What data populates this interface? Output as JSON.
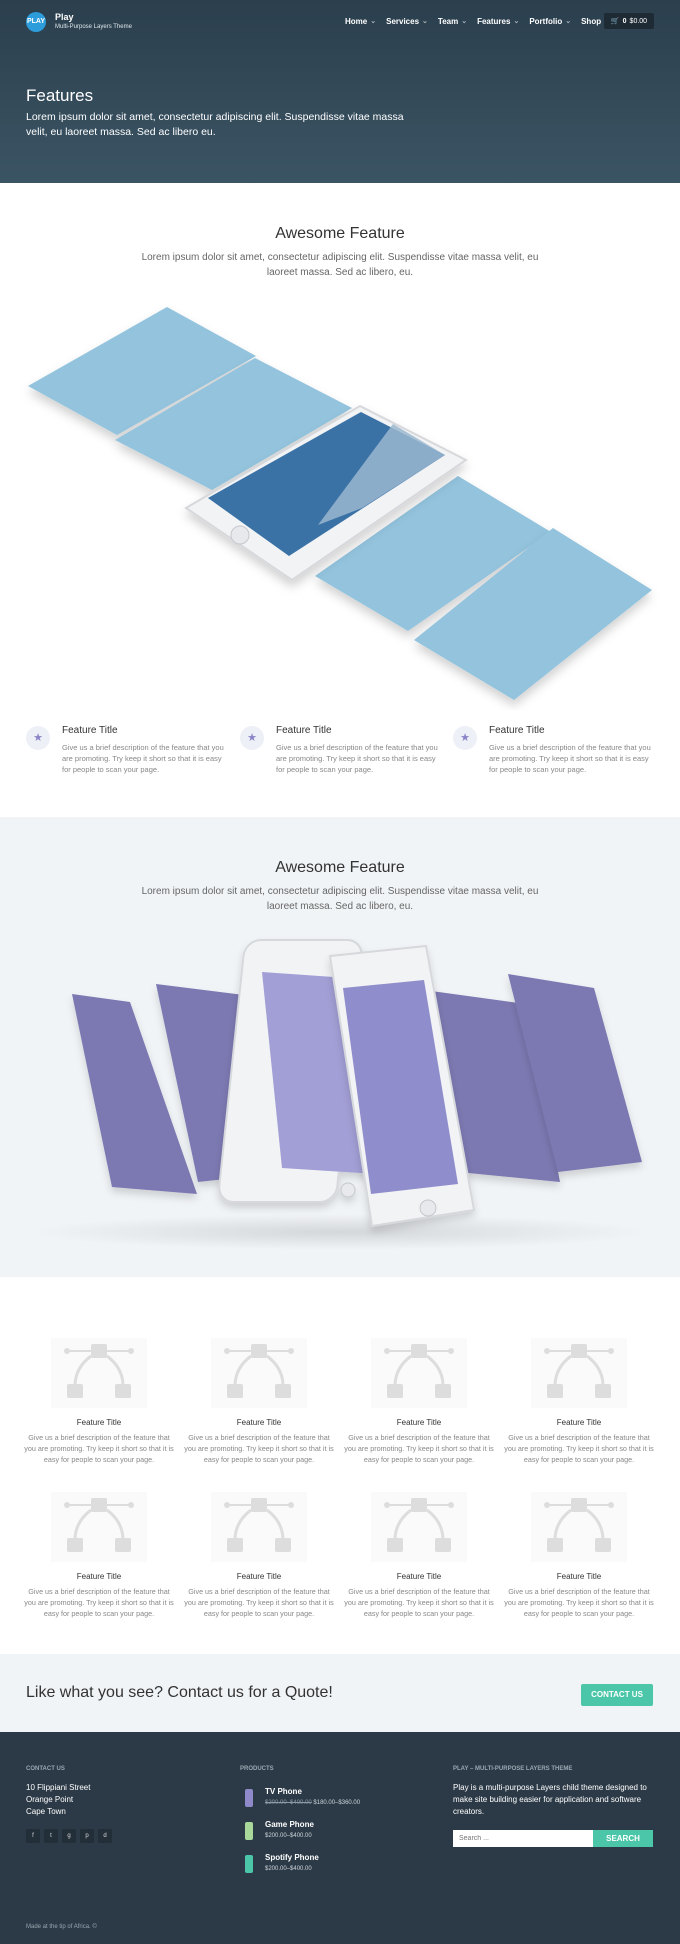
{
  "header": {
    "logo_text": "PLAY",
    "brand": "Play",
    "tagline": "Multi-Purpose Layers Theme",
    "nav": [
      "Home",
      "Services",
      "Team",
      "Features",
      "Portfolio",
      "Shop"
    ],
    "cart_count": "0",
    "cart_total": "$0.00"
  },
  "hero": {
    "title": "Features",
    "intro": "Lorem ipsum dolor sit amet, consectetur adipiscing elit. Suspendisse vitae massa velit, eu laoreet massa. Sed ac libero eu."
  },
  "section1": {
    "title": "Awesome Feature",
    "text": "Lorem ipsum dolor sit amet, consectetur adipiscing elit. Suspendisse vitae massa velit, eu laoreet massa. Sed ac libero, eu.",
    "features": [
      {
        "title": "Feature Title",
        "desc": "Give us a brief description of the feature that you are promoting. Try keep it short so that it is easy for people to scan your page."
      },
      {
        "title": "Feature Title",
        "desc": "Give us a brief description of the feature that you are promoting. Try keep it short so that it is easy for people to scan your page."
      },
      {
        "title": "Feature Title",
        "desc": "Give us a brief description of the feature that you are promoting. Try keep it short so that it is easy for people to scan your page."
      }
    ]
  },
  "section2": {
    "title": "Awesome Feature",
    "text": "Lorem ipsum dolor sit amet, consectetur adipiscing elit. Suspendisse vitae massa velit, eu laoreet massa. Sed ac libero, eu."
  },
  "grid": [
    {
      "title": "Feature Title",
      "desc": "Give us a brief description of the feature that you are promoting. Try keep it short so that it is easy for people to scan your page."
    },
    {
      "title": "Feature Title",
      "desc": "Give us a brief description of the feature that you are promoting. Try keep it short so that it is easy for people to scan your page."
    },
    {
      "title": "Feature Title",
      "desc": "Give us a brief description of the feature that you are promoting. Try keep it short so that it is easy for people to scan your page."
    },
    {
      "title": "Feature Title",
      "desc": "Give us a brief description of the feature that you are promoting. Try keep it short so that it is easy for people to scan your page."
    },
    {
      "title": "Feature Title",
      "desc": "Give us a brief description of the feature that you are promoting. Try keep it short so that it is easy for people to scan your page."
    },
    {
      "title": "Feature Title",
      "desc": "Give us a brief description of the feature that you are promoting. Try keep it short so that it is easy for people to scan your page."
    },
    {
      "title": "Feature Title",
      "desc": "Give us a brief description of the feature that you are promoting. Try keep it short so that it is easy for people to scan your page."
    },
    {
      "title": "Feature Title",
      "desc": "Give us a brief description of the feature that you are promoting. Try keep it short so that it is easy for people to scan your page."
    }
  ],
  "cta": {
    "text": "Like what you see? Contact us for a Quote!",
    "button": "CONTACT US"
  },
  "footer": {
    "contact_heading": "CONTACT US",
    "address": [
      "10 Flippiani Street",
      "Orange Point",
      "Cape Town"
    ],
    "social_icons": [
      "facebook-icon",
      "twitter-icon",
      "google-plus-icon",
      "pinterest-icon",
      "dribbble-icon"
    ],
    "social_glyphs": [
      "f",
      "t",
      "g",
      "p",
      "d"
    ],
    "products_heading": "PRODUCTS",
    "products": [
      {
        "name": "TV Phone",
        "old_price": "$200.00–$400.00",
        "price": "$180.00–$360.00",
        "color": "#8f88c9"
      },
      {
        "name": "Game Phone",
        "old_price": "",
        "price": "$200.00–$400.00",
        "color": "#a9d89b"
      },
      {
        "name": "Spotify Phone",
        "old_price": "",
        "price": "$200.00–$400.00",
        "color": "#4bc6a8"
      }
    ],
    "about_heading": "PLAY – MULTI-PURPOSE LAYERS THEME",
    "about_text": "Play is a multi-purpose Layers child theme designed to make site building easier for application and software creators.",
    "search_placeholder": "Search ...",
    "search_button": "SEARCH",
    "credit": "Made at the tip of Africa. ©"
  },
  "colors": {
    "accent": "#4bc6a8",
    "header_bg": "#34495a",
    "footer_bg": "#2c3a47",
    "blue_screens": "#93c3dd",
    "purple_screens": "#7b79b2"
  }
}
